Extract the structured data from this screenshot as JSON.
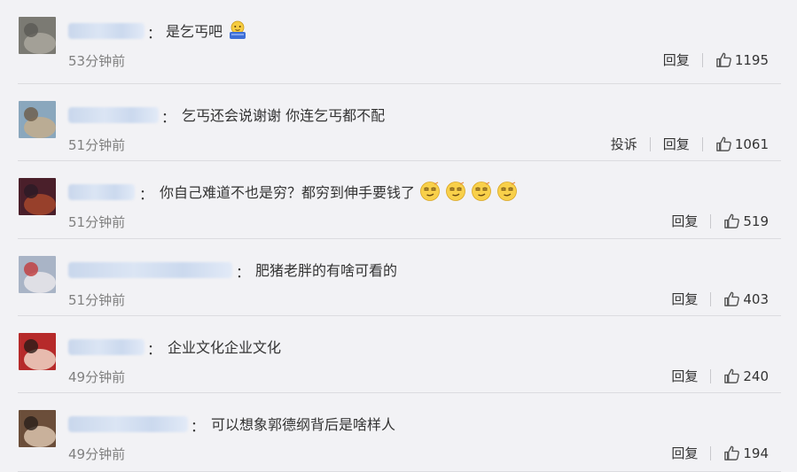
{
  "comments": [
    {
      "text": "是乞丐吧",
      "emoji": "lunchbox-emoji",
      "emoji_count": 1,
      "time": "53分钟前",
      "report": "",
      "reply": "回复",
      "likes": "1195",
      "avatar_colors": [
        "#7b7a73",
        "#aaa79e",
        "#5b5a55"
      ]
    },
    {
      "text": "乞丐还会说谢谢 你连乞丐都不配",
      "emoji": "",
      "emoji_count": 0,
      "time": "51分钟前",
      "report": "投诉",
      "reply": "回复",
      "likes": "1061",
      "avatar_colors": [
        "#8aa7bd",
        "#c2ad8d",
        "#6d5c48"
      ]
    },
    {
      "text": "你自己难道不也是穷？都穷到伸手要钱了",
      "emoji": "smirk-emoji",
      "emoji_count": 4,
      "time": "51分钟前",
      "report": "",
      "reply": "回复",
      "likes": "519",
      "avatar_colors": [
        "#4a1f2a",
        "#a5462b",
        "#2a1a25"
      ]
    },
    {
      "text": "肥猪老胖的有啥可看的",
      "emoji": "",
      "emoji_count": 0,
      "time": "51分钟前",
      "report": "",
      "reply": "回复",
      "likes": "403",
      "avatar_colors": [
        "#a9b4c6",
        "#e9e6ea",
        "#c23b3b"
      ]
    },
    {
      "text": "企业文化企业文化",
      "emoji": "",
      "emoji_count": 0,
      "time": "49分钟前",
      "report": "",
      "reply": "回复",
      "likes": "240",
      "avatar_colors": [
        "#b62a2a",
        "#f0d5c6",
        "#2a1b18"
      ]
    },
    {
      "text": "可以想象郭德纲背后是啥样人",
      "emoji": "",
      "emoji_count": 0,
      "time": "49分钟前",
      "report": "",
      "reply": "回复",
      "likes": "194",
      "avatar_colors": [
        "#6b4e3a",
        "#d9c3ad",
        "#2b211c"
      ]
    }
  ],
  "colon": "："
}
